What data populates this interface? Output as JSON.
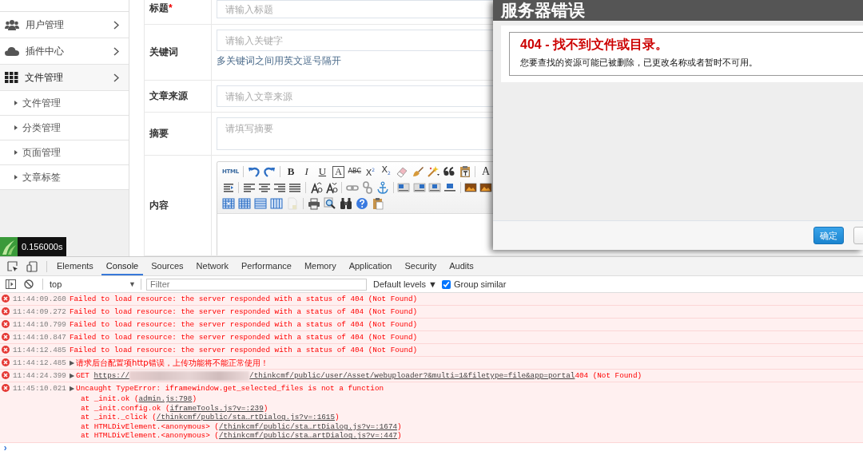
{
  "sidebar": {
    "items": [
      {
        "label": "用户管理",
        "expanded": false
      },
      {
        "label": "插件中心",
        "expanded": false
      },
      {
        "label": "文件管理",
        "expanded": true,
        "children": [
          {
            "label": "文件管理"
          },
          {
            "label": "分类管理"
          },
          {
            "label": "页面管理"
          },
          {
            "label": "文章标签"
          }
        ]
      }
    ],
    "timer": "0.156000s"
  },
  "form": {
    "fields": [
      {
        "label": "标题",
        "required_mark": "*",
        "kind": "input",
        "placeholder": "请输入标题"
      },
      {
        "label": "关键词",
        "kind": "input",
        "placeholder": "请输入关键字",
        "hint": "多关键词之间用英文逗号隔开"
      },
      {
        "label": "文章来源",
        "kind": "input",
        "placeholder": "请输入文章来源"
      },
      {
        "label": "摘要",
        "kind": "textarea",
        "placeholder": "请填写摘要"
      },
      {
        "label": "内容",
        "kind": "editor"
      }
    ],
    "editor": {
      "toolbar_rows": [
        [
          {
            "kind": "html",
            "label": "HTML"
          },
          {
            "kind": "sep"
          },
          {
            "kind": "undo"
          },
          {
            "kind": "redo"
          },
          {
            "kind": "sep"
          },
          {
            "kind": "bold",
            "label": "B"
          },
          {
            "kind": "italic",
            "label": "I"
          },
          {
            "kind": "underline",
            "label": "U"
          },
          {
            "kind": "font-border",
            "label": "A"
          },
          {
            "kind": "strike",
            "label": "ABC"
          },
          {
            "kind": "superscript",
            "label": "X$^{2}$"
          },
          {
            "kind": "subscript",
            "label": "X$_{2}$"
          },
          {
            "kind": "eraser"
          },
          {
            "kind": "brush"
          },
          {
            "kind": "wand"
          },
          {
            "kind": "quote"
          },
          {
            "kind": "paste"
          },
          {
            "kind": "sep"
          },
          {
            "kind": "font",
            "label": "A"
          }
        ],
        [
          {
            "kind": "indent"
          },
          {
            "kind": "sep"
          },
          {
            "kind": "align-left"
          },
          {
            "kind": "align-center"
          },
          {
            "kind": "align-right"
          },
          {
            "kind": "justify"
          },
          {
            "kind": "sep"
          },
          {
            "kind": "font-up"
          },
          {
            "kind": "font-down"
          },
          {
            "kind": "sep"
          },
          {
            "kind": "link"
          },
          {
            "kind": "unlink"
          },
          {
            "kind": "anchor"
          },
          {
            "kind": "sep"
          },
          {
            "kind": "float-left"
          },
          {
            "kind": "float-right"
          },
          {
            "kind": "float-none"
          },
          {
            "kind": "float-center"
          },
          {
            "kind": "sep"
          },
          {
            "kind": "image"
          },
          {
            "kind": "image"
          }
        ],
        [
          {
            "kind": "table-insert"
          },
          {
            "kind": "table-grid"
          },
          {
            "kind": "table-rows"
          },
          {
            "kind": "table-cols"
          },
          {
            "kind": "document"
          },
          {
            "kind": "sep"
          },
          {
            "kind": "print"
          },
          {
            "kind": "preview"
          },
          {
            "kind": "find"
          },
          {
            "kind": "help"
          },
          {
            "kind": "clipboard"
          }
        ]
      ]
    }
  },
  "dialog": {
    "title": "服务器错误",
    "heading": "404 - 找不到文件或目录。",
    "message": "您要查找的资源可能已被删除，已更改名称或者暂时不可用。",
    "buttons": [
      {
        "kind": "primary",
        "label": "确定"
      },
      {
        "kind": "secondary"
      }
    ]
  },
  "devtools": {
    "tabs": [
      {
        "label": "Elements",
        "selected": false
      },
      {
        "label": "Console",
        "selected": true
      },
      {
        "label": "Sources",
        "selected": false
      },
      {
        "label": "Network",
        "selected": false
      },
      {
        "label": "Performance",
        "selected": false
      },
      {
        "label": "Memory",
        "selected": false
      },
      {
        "label": "Application",
        "selected": false
      },
      {
        "label": "Security",
        "selected": false
      },
      {
        "label": "Audits",
        "selected": false
      }
    ],
    "toolbar": {
      "context": "top",
      "context_caret": "▼",
      "filter_placeholder": "Filter",
      "levels": "Default levels",
      "levels_caret": "▼",
      "group_similar": {
        "label": "Group similar",
        "checked": true
      }
    },
    "messages": [
      {
        "kind": "resource",
        "time": "11:44:09.260",
        "text": "Failed to load resource: the server responded with a status of 404 (Not Found)"
      },
      {
        "kind": "resource",
        "time": "11:44:09.272",
        "text": "Failed to load resource: the server responded with a status of 404 (Not Found)"
      },
      {
        "kind": "resource",
        "time": "11:44:10.799",
        "text": "Failed to load resource: the server responded with a status of 404 (Not Found)"
      },
      {
        "kind": "resource",
        "time": "11:44:10.847",
        "text": "Failed to load resource: the server responded with a status of 404 (Not Found)"
      },
      {
        "kind": "resource",
        "time": "11:44:12.485",
        "text": "Failed to load resource: the server responded with a status of 404 (Not Found)"
      },
      {
        "kind": "alert",
        "time": "11:44:12.485",
        "expander": "▶",
        "text": "请求后台配置项http错误，上传功能将不能正常使用！"
      },
      {
        "kind": "request",
        "time": "11:44:24.399",
        "expander": "▶",
        "method": "GET",
        "url_parts": [
          "https://",
          "/thinkcmf/public/user/Asset/webuploader?&multi=1&filetype=file&app=portal"
        ],
        "status": "404 (Not Found)"
      },
      {
        "kind": "exception",
        "time": "11:45:10.021",
        "expander": "▶",
        "text": "Uncaught TypeError: iframewindow.get_selected_files is not a function",
        "stack": [
          {
            "before": "at _init.ok (",
            "link": "admin.js:798",
            "after": ")"
          },
          {
            "before": "at _init.config.ok (",
            "link": "iframeTools.js?v=:239",
            "after": ")"
          },
          {
            "before": "at _init._click (",
            "link": "/thinkcmf/public/sta…rtDialog.js?v=:1615",
            "after": ")"
          },
          {
            "before": "at HTMLDivElement.<anonymous> (",
            "link": "/thinkcmf/public/sta…rtDialog.js?v=:1674",
            "after": ")"
          },
          {
            "before": "at HTMLDivElement.<anonymous> (",
            "link": "/thinkcmf/public/sta…artDialog.js?v=:447",
            "after": ")"
          }
        ]
      }
    ],
    "prompt": "›"
  }
}
